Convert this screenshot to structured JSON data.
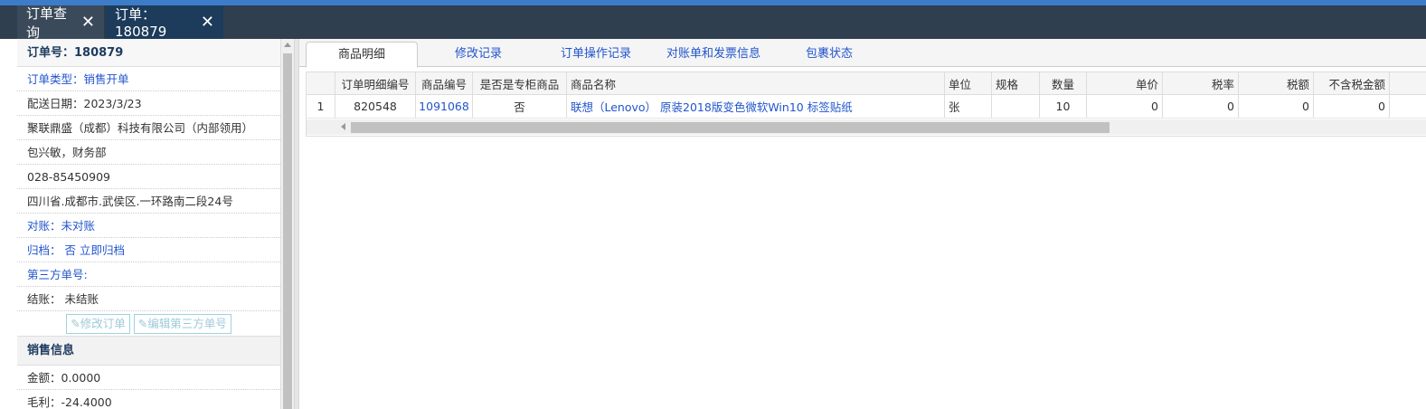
{
  "tabs": [
    {
      "label": "订单查询"
    },
    {
      "label": "订单：180879"
    }
  ],
  "left": {
    "order_title": "订单号：180879",
    "rows": {
      "order_type": "订单类型：销售开单",
      "delivery_date": "配送日期：2023/3/23",
      "company": "聚联鼎盛（成都）科技有限公司（内部领用）",
      "contact": "包兴敏，财务部",
      "phone": "028-85450909",
      "address": "四川省.成都市.武侯区.一环路南二段24号",
      "reconcile": "对账：未对账",
      "archive_label": "归档：",
      "archive_value": "否 立即归档",
      "third_party": "第三方单号:",
      "settle_label": "结账：",
      "settle_value": "未结账"
    },
    "buttons": {
      "edit_order": "修改订单",
      "edit_third": "编辑第三方单号"
    },
    "sales_title": "销售信息",
    "sales": {
      "amount": "金额：0.0000",
      "profit": "毛利：-24.4000"
    }
  },
  "subtabs": [
    {
      "label": "商品明细"
    },
    {
      "label": "修改记录"
    },
    {
      "label": "订单操作记录"
    },
    {
      "label": "对账单和发票信息"
    },
    {
      "label": "包裹状态"
    }
  ],
  "grid": {
    "headers": [
      "",
      "订单明细编号",
      "商品编号",
      "是否是专柜商品",
      "商品名称",
      "单位",
      "规格",
      "数量",
      "单价",
      "税率",
      "税额",
      "不含税金额"
    ],
    "rows": [
      [
        "1",
        "820548",
        "1091068",
        "否",
        "联想（Lenovo） 原装2018版变色微软Win10 标签贴纸",
        "张",
        "",
        "10",
        "0",
        "0",
        "0",
        "0"
      ]
    ]
  },
  "colors": {
    "accent_blue": "#3d7cc9",
    "tabbar": "#2f3f4f",
    "link": "#2255cc"
  }
}
